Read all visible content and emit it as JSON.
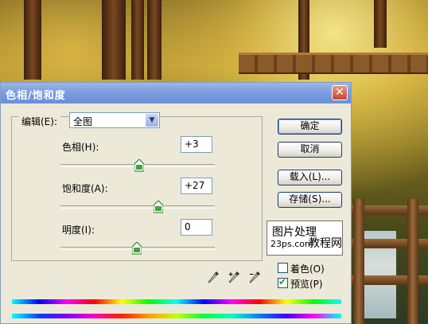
{
  "dialog": {
    "title": "色相/饱和度",
    "close_glyph": "✕"
  },
  "edit": {
    "label": "编辑(E):",
    "selected": "全图"
  },
  "hue": {
    "label": "色相(H):",
    "value": "+3",
    "slider_fraction": 0.51
  },
  "saturation": {
    "label": "饱和度(A):",
    "value": "+27",
    "slider_fraction": 0.635
  },
  "lightness": {
    "label": "明度(I):",
    "value": "0",
    "slider_fraction": 0.5
  },
  "buttons": {
    "ok": "确定",
    "cancel": "取消",
    "load": "载入(L)...",
    "save": "存储(S)..."
  },
  "watermark": {
    "line1": "图片处理",
    "line2": "23ps.com",
    "line3": "教程网"
  },
  "options": {
    "colorize_label": "着色(O)",
    "colorize_checked": false,
    "preview_label": "预览(P)",
    "preview_checked": true
  },
  "icons": {
    "eyedropper": "eyedropper-icon",
    "eyedropper_plus": "eyedropper-plus-icon",
    "eyedropper_minus": "eyedropper-minus-icon"
  },
  "colors": {
    "title_bar": "#7b9ee0",
    "dialog_bg": "#ece9d8",
    "check_mark": "#21a121"
  }
}
